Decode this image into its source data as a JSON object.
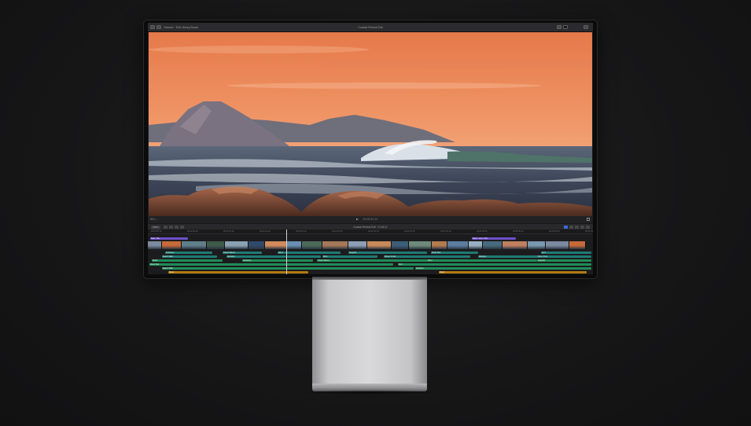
{
  "app": {
    "menu": {
      "library_label": "Glasses · Edit Library  Beach",
      "project_label": "Coastal Retreat Edit",
      "zoom_label": "50% ⌄",
      "view_label": "View ⌄"
    },
    "viewer": {
      "image_description_icon": "sunset-seascape-image"
    },
    "transport": {
      "zoom": "81% ⌄",
      "timecode": "00:00:21:11",
      "fullscreen_icon": "fullscreen-icon",
      "play_icon": "play-icon"
    },
    "timeline": {
      "index_label": "Index",
      "project_title": "Coastal Retreat Edit · 01:05:47",
      "ruler": [
        "00:00:00:00",
        "00:00:05:00",
        "00:00:10:00",
        "00:00:15:00",
        "00:00:20:00",
        "00:00:25:00",
        "00:00:30:00",
        "00:00:35:00",
        "00:00:40:00",
        "00:00:45:00",
        "00:00:50:00",
        "00:00:55:00",
        "00:01:00:00"
      ],
      "title_clips": [
        "Basic Title",
        "Basic Lower Third"
      ],
      "audio_clips": [
        "Ambience",
        "Ocean Waves",
        "Wind",
        "Seagulls",
        "Music Bed",
        "Surf",
        "Beach Walk",
        "Narration",
        "Birds",
        "Waves Crash",
        "Dialogue",
        "Room Tone",
        "Music"
      ]
    }
  },
  "colors": {
    "title_clip": "#6c4fc9",
    "audio_teal": "#1f7b74",
    "audio_green": "#1f8d58",
    "audio_orange": "#b07a12",
    "sky_top": "#e98550",
    "sky_horizon": "#f4b08a"
  }
}
